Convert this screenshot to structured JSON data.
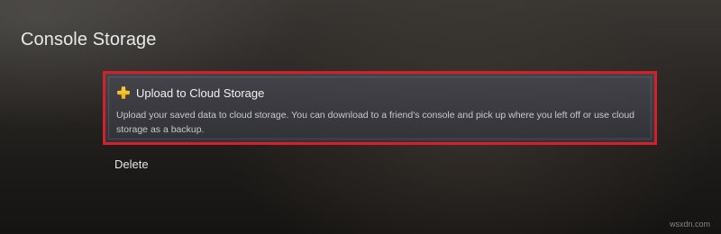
{
  "page": {
    "title": "Console Storage"
  },
  "menu": {
    "items": [
      {
        "label": "Upload to Cloud Storage",
        "icon": "ps-plus-icon",
        "description": "Upload your saved data to cloud storage. You can download to a friend's console and pick up where you left off or use cloud storage as a backup."
      },
      {
        "label": "Delete"
      }
    ]
  },
  "watermark": {
    "text": "wsxdn.com"
  },
  "colors": {
    "focus_border": "#d3202b",
    "ps_plus_yellow": "#f2b81e"
  }
}
